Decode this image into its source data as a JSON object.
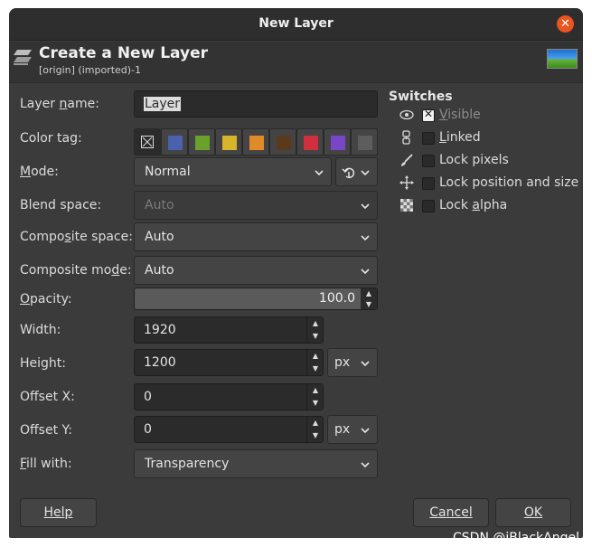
{
  "window": {
    "title": "New Layer"
  },
  "header": {
    "title": "Create a New Layer",
    "subtitle": "[origin] (imported)-1"
  },
  "form": {
    "layer_name_label": "Layer name:",
    "layer_name_value": "Layer",
    "color_tag_label": "Color tag:",
    "color_tags": [
      "#4a62ad",
      "#6aa12b",
      "#d7b52a",
      "#e08a2a",
      "#5b3a1c",
      "#d02f3d",
      "#7a46c8",
      "#5d5d5d"
    ],
    "mode_label": "Mode:",
    "mode_value": "Normal",
    "blend_space_label": "Blend space:",
    "blend_space_value": "Auto",
    "composite_space_label": "Composite space:",
    "composite_space_value": "Auto",
    "composite_mode_label": "Composite mode:",
    "composite_mode_value": "Auto",
    "opacity_label": "Opacity:",
    "opacity_value": "100.0",
    "width_label": "Width:",
    "width_value": "1920",
    "height_label": "Height:",
    "height_value": "1200",
    "size_unit": "px",
    "offset_x_label": "Offset X:",
    "offset_x_value": "0",
    "offset_y_label": "Offset Y:",
    "offset_y_value": "0",
    "offset_unit": "px",
    "fill_label": "Fill with:",
    "fill_value": "Transparency"
  },
  "switches": {
    "title": "Switches",
    "items": [
      {
        "label": "Visible",
        "checked": true,
        "icon": "eye-icon"
      },
      {
        "label": "Linked",
        "checked": false,
        "icon": "chain-icon"
      },
      {
        "label": "Lock pixels",
        "checked": false,
        "icon": "brush-icon"
      },
      {
        "label": "Lock position and size",
        "checked": false,
        "icon": "move-icon"
      },
      {
        "label": "Lock alpha",
        "checked": false,
        "icon": "checkerboard-icon"
      }
    ]
  },
  "buttons": {
    "help": "Help",
    "cancel": "Cancel",
    "ok": "OK"
  },
  "watermark": "CSDN @iBlackAngel",
  "colors": {
    "window_bg": "#3b3b3b",
    "close": "#e95420",
    "field_bg": "#2b2b2b"
  }
}
